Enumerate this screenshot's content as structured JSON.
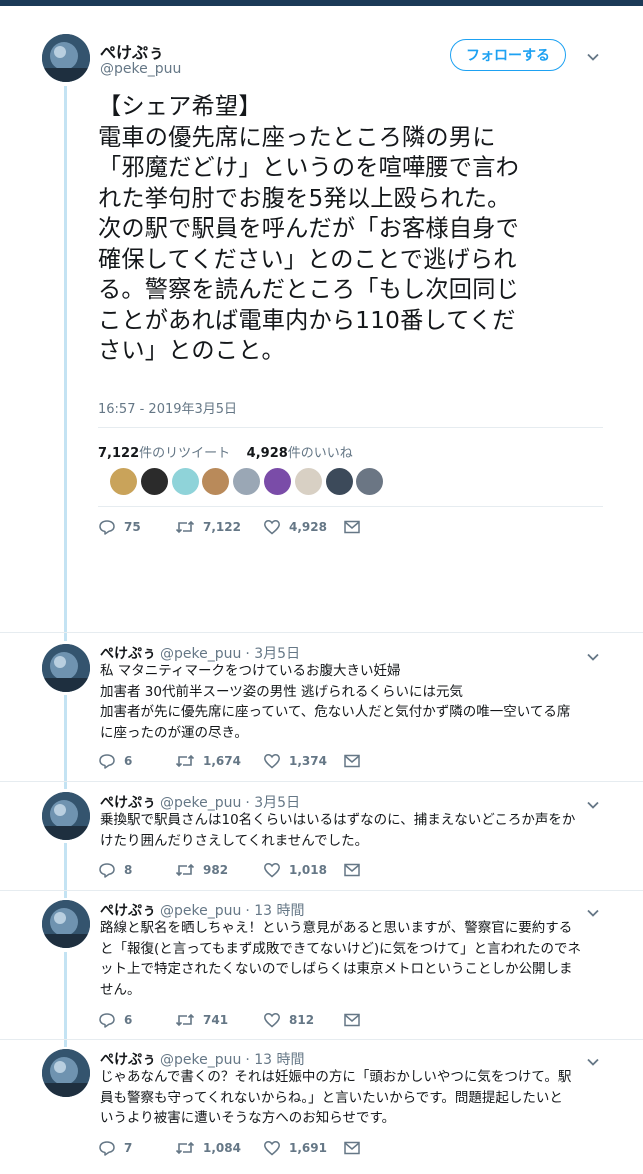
{
  "main_tweet": {
    "display_name": "ぺけぷぅ",
    "handle": "@peke_puu",
    "follow_label": "フォローする",
    "text_lines": [
      "【シェア希望】",
      "電車の優先席に座ったところ隣の男に",
      "「邪魔だどけ」というのを喧嘩腰で言わ",
      "れた挙句肘でお腹を5発以上殴られた。",
      "次の駅で駅員を呼んだが「お客様自身で",
      "確保してください」とのことで逃げられ",
      "る。警察を読んだところ「もし次回同じ",
      "ことがあれば電車内から110番してくだ",
      "さい」とのこと。"
    ],
    "timestamp": "16:57 - 2019年3月5日",
    "retweet_count": "7,122",
    "retweet_suffix": "件のリツイート",
    "like_count": "4,928",
    "like_suffix": "件のいいね",
    "actions": {
      "replies": "75",
      "retweets": "7,122",
      "likes": "4,928"
    },
    "liker_colors": [
      "#c9a35a",
      "#2b2b2b",
      "#8fd3d9",
      "#b98a5a",
      "#9aa7b5",
      "#7a4ca8",
      "#d8d0c4",
      "#3c4a5a",
      "#6b7684"
    ]
  },
  "replies": [
    {
      "display_name": "ぺけぷぅ",
      "handle": "@peke_puu",
      "time": "· 3月5日",
      "lines": [
        "私 マタニティマークをつけているお腹大きい妊婦",
        "加害者 30代前半スーツ姿の男性 逃げられるくらいには元気",
        "加害者が先に優先席に座っていて、危ない人だと気付かず隣の唯一空いてる席",
        "に座ったのが運の尽き。"
      ],
      "actions": {
        "replies": "6",
        "retweets": "1,674",
        "likes": "1,374"
      }
    },
    {
      "display_name": "ぺけぷぅ",
      "handle": "@peke_puu",
      "time": "· 3月5日",
      "lines": [
        "乗換駅で駅員さんは10名くらいはいるはずなのに、捕まえないどころか声をか",
        "けたり囲んだりさえしてくれませんでした。"
      ],
      "actions": {
        "replies": "8",
        "retweets": "982",
        "likes": "1,018"
      }
    },
    {
      "display_name": "ぺけぷぅ",
      "handle": "@peke_puu",
      "time": "· 13 時間",
      "lines": [
        "路線と駅名を晒しちゃえ！という意見があると思いますが、警察官に要約する",
        "と「報復(と言ってもまず成敗できてないけど)に気をつけて」と言われたのでネ",
        "ット上で特定されたくないのでしばらくは東京メトロということしか公開しま",
        "せん。"
      ],
      "actions": {
        "replies": "6",
        "retweets": "741",
        "likes": "812"
      }
    },
    {
      "display_name": "ぺけぷぅ",
      "handle": "@peke_puu",
      "time": "· 13 時間",
      "lines": [
        "じゃあなんで書くの？それは妊娠中の方に「頭おかしいやつに気をつけて。駅",
        "員も警察も守ってくれないからね。」と言いたいからです。問題提起したいと",
        "いうより被害に遭いそうな方へのお知らせです。"
      ],
      "actions": {
        "replies": "7",
        "retweets": "1,084",
        "likes": "1,691"
      }
    }
  ]
}
